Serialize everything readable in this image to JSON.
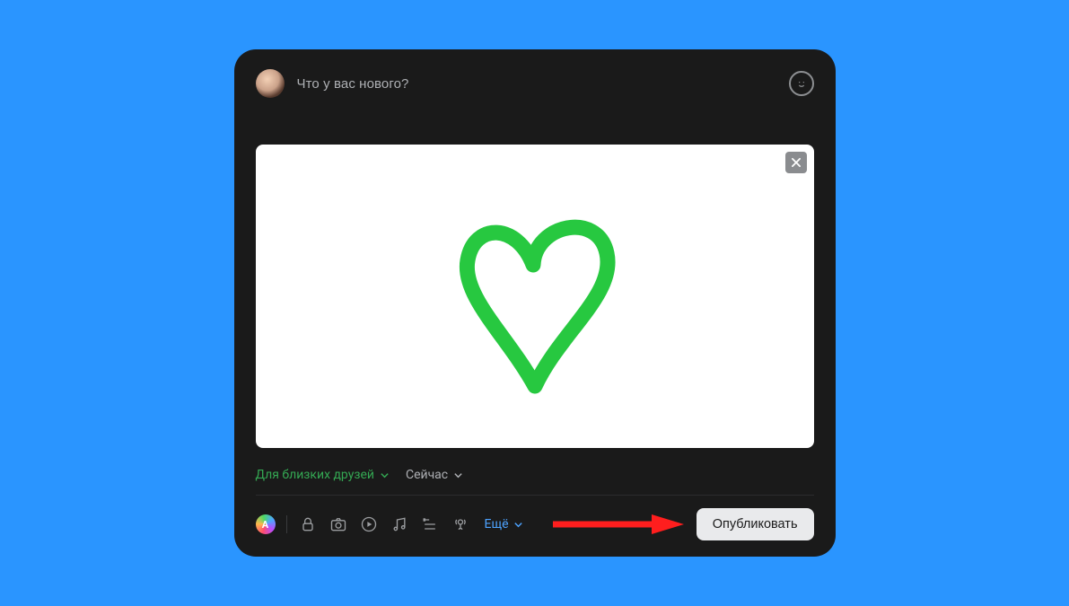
{
  "composer": {
    "placeholder": "Что у вас нового?"
  },
  "audience": {
    "label": "Для близких друзей"
  },
  "schedule": {
    "label": "Сейчас"
  },
  "toolbar": {
    "theme_badge_letter": "A",
    "more_label": "Ещё"
  },
  "publish": {
    "label": "Опубликовать"
  },
  "attachment": {
    "remove_glyph": ""
  },
  "colors": {
    "accent_audience": "#34a853",
    "accent_link": "#4da3ff",
    "heart_stroke": "#27c840"
  }
}
